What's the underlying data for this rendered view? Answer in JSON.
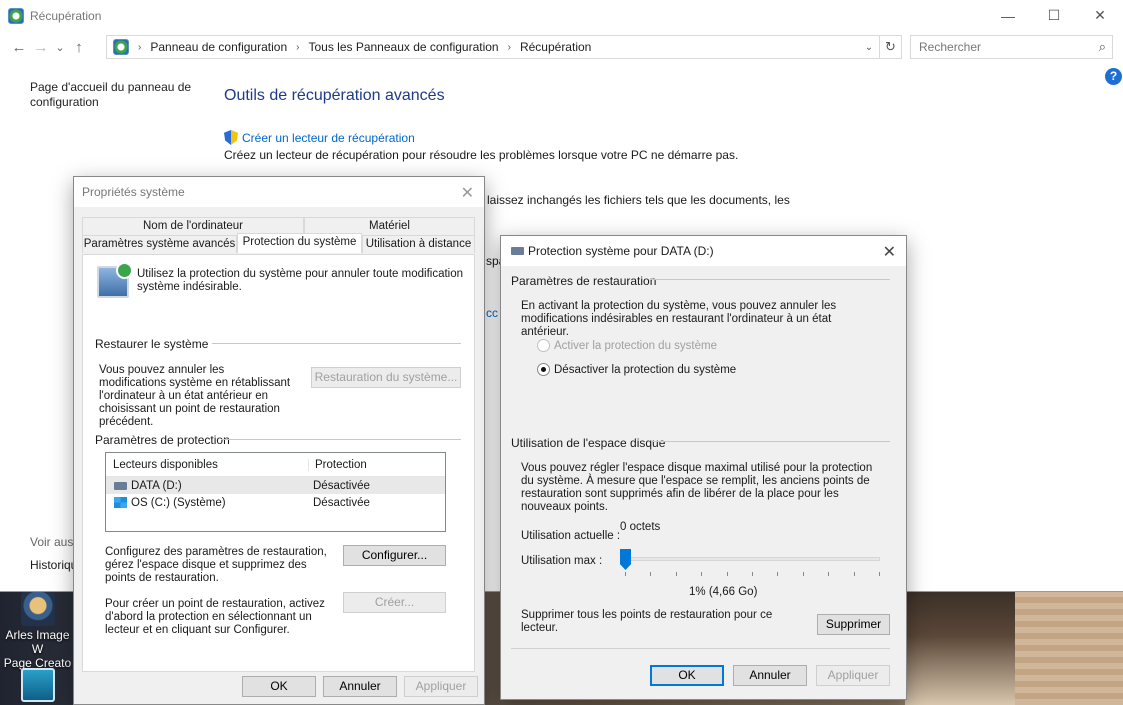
{
  "window": {
    "title": "Récupération",
    "controls": {
      "minimize": "—",
      "maximize": "☐",
      "close": "✕"
    }
  },
  "nav": {
    "back": "←",
    "forward": "→",
    "recent": "⌄",
    "up": "↑",
    "breadcrumbs": [
      "Panneau de configuration",
      "Tous les Panneaux de configuration",
      "Récupération"
    ],
    "search_placeholder": "Rechercher"
  },
  "left_pane": {
    "home_link": "Page d'accueil du panneau de configuration",
    "see_also": "Voir aussi",
    "history": "Historique"
  },
  "main": {
    "title": "Outils de récupération avancés",
    "create_drive_link": "Créer un lecteur de récupération",
    "create_drive_desc": "Créez un lecteur de récupération pour résoudre les problèmes lorsque votre PC ne démarre pas.",
    "partial_desc": "laissez inchangés les fichiers tels que les documents, les",
    "partial_a": "spa",
    "partial_b": "cc"
  },
  "desktop_icons": [
    {
      "label_line1": "Arles Image W",
      "label_line2": "Page Creato"
    }
  ],
  "props": {
    "title": "Propriétés système",
    "tabs_top": [
      "Nom de l'ordinateur",
      "Matériel"
    ],
    "tabs_bottom": [
      "Paramètres système avancés",
      "Protection du système",
      "Utilisation à distance"
    ],
    "intro": "Utilisez la protection du système pour annuler toute modification système indésirable.",
    "restore_group": "Restaurer le système",
    "restore_text": "Vous pouvez annuler les modifications système en rétablissant l'ordinateur à un état antérieur en choisissant un point de restauration précédent.",
    "restore_button": "Restauration du système...",
    "protection_group": "Paramètres de protection",
    "col_drives": "Lecteurs disponibles",
    "col_protection": "Protection",
    "drives": [
      {
        "name": "DATA (D:)",
        "status": "Désactivée"
      },
      {
        "name": "OS (C:) (Système)",
        "status": "Désactivée"
      }
    ],
    "configure_text": "Configurez des paramètres de restauration, gérez l'espace disque et supprimez des points de restauration.",
    "configure_button": "Configurer...",
    "create_text": "Pour créer un point de restauration, activez d'abord la protection en sélectionnant un lecteur et en cliquant sur Configurer.",
    "create_button": "Créer...",
    "ok": "OK",
    "cancel": "Annuler",
    "apply": "Appliquer"
  },
  "prot": {
    "title": "Protection système pour DATA (D:)",
    "restore_group": "Paramètres de restauration",
    "restore_text": "En activant la protection du système, vous pouvez annuler les modifications indésirables en restaurant l'ordinateur à un état antérieur.",
    "radio_enable": "Activer la protection du système",
    "radio_disable": "Désactiver la protection du système",
    "disk_group": "Utilisation de l'espace disque",
    "disk_text": "Vous pouvez régler l'espace disque maximal utilisé pour la protection du système. À mesure que l'espace se remplit, les anciens points de restauration sont supprimés afin de libérer de la place pour les nouveaux points.",
    "current_label": "Utilisation actuelle :",
    "current_value": "0 octets",
    "max_label": "Utilisation max :",
    "max_value": "1% (4,66 Go)",
    "slider_level": 0.01,
    "delete_text": "Supprimer tous les points de restauration pour ce lecteur.",
    "delete_button": "Supprimer",
    "ok": "OK",
    "cancel": "Annuler",
    "apply": "Appliquer"
  }
}
